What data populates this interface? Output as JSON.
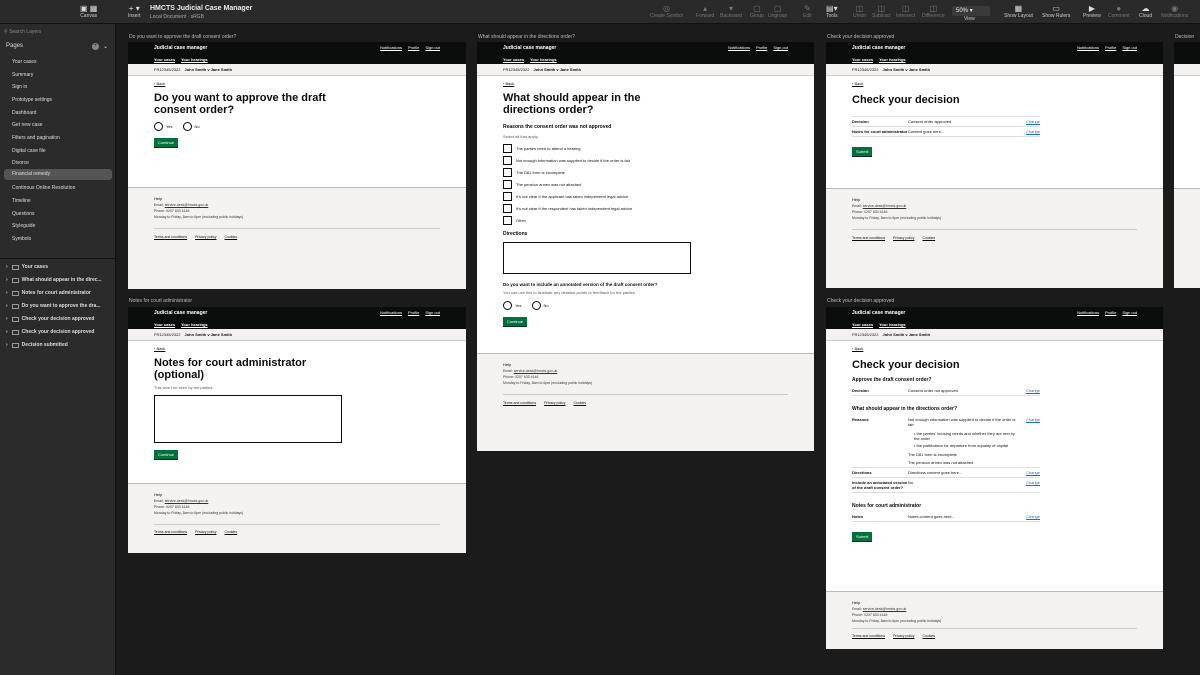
{
  "toolbar": {
    "insert_label": "Insert",
    "canvas_label": "Canvas",
    "document_title": "HMCTS Judicial Case Manager",
    "document_subtitle": "Local Document · sRGB",
    "tools": [
      "Create Symbol",
      "Forward",
      "Backward",
      "Group",
      "Ungroup",
      "Edit",
      "Tools",
      "Union",
      "Subtract",
      "Intersect",
      "Difference"
    ],
    "zoom": "50%",
    "view_label": "View",
    "right_tools": [
      "Show Layout",
      "Show Rulers",
      "Preview",
      "Comment",
      "Cloud",
      "Notifications"
    ]
  },
  "sidebar": {
    "search_placeholder": "Search Layers",
    "pages_heading": "Pages",
    "pages": [
      "Your cases",
      "Summary",
      "Sign in",
      "Prototype settings",
      "Dashboard",
      "Get new case",
      "Filters and pagination",
      "Digital case file",
      "Divorce",
      "Financial remedy",
      "Continous Online Resolution",
      "Timeline",
      "Questions",
      "Styleguide",
      "Symbols"
    ],
    "selected_page": "Financial remedy",
    "layers": [
      "Your cases",
      "What should appear in the direc...",
      "Notes for court administrator",
      "Do you want to approve the dra...",
      "Check your decision approved",
      "Check your decision approved",
      "Decision submitted"
    ]
  },
  "common": {
    "service": "Judicial case manager",
    "nav": [
      "Notifications",
      "Profile",
      "Sign out"
    ],
    "notif_count": "1",
    "subnav": [
      "Your cases",
      "Your hearings"
    ],
    "case_ref": "FR12345/2322",
    "parties": "John Smith v Jane Smith",
    "back": "Back",
    "continue": "Continue",
    "submit": "Submit",
    "yes": "Yes",
    "no": "No",
    "change": "Change",
    "help": "Help",
    "email_label": "Email:",
    "email": "service-desk@hmcts.gov.uk",
    "phone": "Phone: 0207 633 4146",
    "hours": "Monday to Friday, 8am to 6pm (excluding public holidays)",
    "footer_links": [
      "Terms and conditions",
      "Privacy policy",
      "Cookies"
    ]
  },
  "artboards": {
    "approve": {
      "label": "Do you want to approve the draft consent order?",
      "heading": "Do you want to approve the draft consent order?"
    },
    "directions": {
      "label": "What should appear in the directions order?",
      "heading": "What should appear in the directions order?",
      "reasons_heading": "Reasons the consent order was not approved",
      "reasons_hint": "Select all that apply.",
      "reasons": [
        "The parties need to attend a hearing",
        "Not enough information was supplied to decide if the order is fair",
        "The D81 form is incomplete",
        "The pension annex was not attached",
        "It's not clear if the applicant has taken independent legal advice",
        "It's not clear if the respondent has taken independent legal advice",
        "Other"
      ],
      "directions_heading": "Directions",
      "annotated_heading": "Do you want to include an annotated version of the draft consent order?",
      "annotated_hint": "You can use this to illustrate any detailed points or feedback for the parties."
    },
    "check_approved": {
      "label": "Check your decision approved",
      "heading": "Check your decision",
      "rows": [
        {
          "key": "Decision",
          "value": "Consent order approved"
        },
        {
          "key": "Notes for court administrator",
          "value": "Content goes here..."
        }
      ]
    },
    "notes": {
      "label": "Notes for court administrator",
      "heading": "Notes for court administrator (optional)",
      "hint": "This won't be seen by the parties."
    },
    "check_not_approved": {
      "label": "Check your decision approved",
      "heading": "Check your decision",
      "sec1": "Approve the draft consent order?",
      "decision_key": "Decision",
      "decision_value": "Consent order not approved",
      "sec2": "What should appear in the directions order?",
      "reasons_key": "Reasons",
      "reasons_lines": [
        "Not enough information was supplied to decide if the order is fair:",
        "the parties' housing needs and whether they are met by the order",
        "the justification for departure from equality of capital",
        "The D81 form is incomplete",
        "The pension annex was not attached"
      ],
      "directions_key": "Directions",
      "directions_value": "Directions content goes here...",
      "annotated_key": "Include an annotated version of the draft consent order?",
      "annotated_value": "No",
      "sec3": "Notes for court administrator",
      "notes_key": "Notes",
      "notes_value": "Notes content goes here..."
    },
    "partial_label": "Decision"
  }
}
